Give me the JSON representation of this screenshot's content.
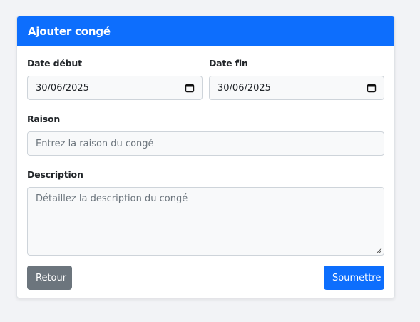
{
  "card": {
    "title": "Ajouter congé"
  },
  "form": {
    "start_date": {
      "label": "Date début",
      "value": "30/06/2025",
      "icon": "calendar-icon"
    },
    "end_date": {
      "label": "Date fin",
      "value": "30/06/2025",
      "icon": "calendar-icon"
    },
    "reason": {
      "label": "Raison",
      "placeholder": "Entrez la raison du congé"
    },
    "description": {
      "label": "Description",
      "placeholder": "Détaillez la description du congé"
    }
  },
  "actions": {
    "back_label": "Retour",
    "submit_label": "Soumettre"
  },
  "colors": {
    "primary": "#0d6efd",
    "secondary": "#6c757d",
    "page_bg": "#f2f3f6"
  }
}
